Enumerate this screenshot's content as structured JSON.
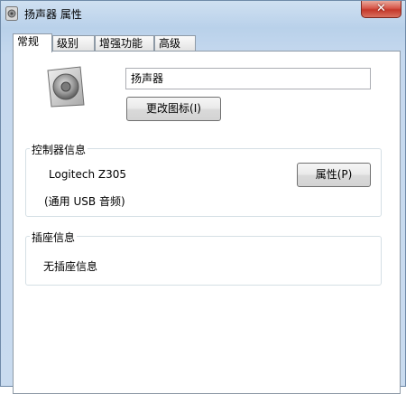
{
  "window": {
    "title": "扬声器 属性",
    "close_label": "✕"
  },
  "tabs": [
    {
      "label": "常规",
      "active": true
    },
    {
      "label": "级别",
      "active": false
    },
    {
      "label": "增强功能",
      "active": false
    },
    {
      "label": "高级",
      "active": false
    }
  ],
  "general": {
    "device_name_value": "扬声器",
    "change_icon_label": "更改图标(I)",
    "controller_group_label": "控制器信息",
    "controller_name": "Logitech Z305",
    "controller_type": "(通用 USB 音频)",
    "properties_label": "属性(P)",
    "jack_group_label": "插座信息",
    "jack_info": "无插座信息"
  }
}
